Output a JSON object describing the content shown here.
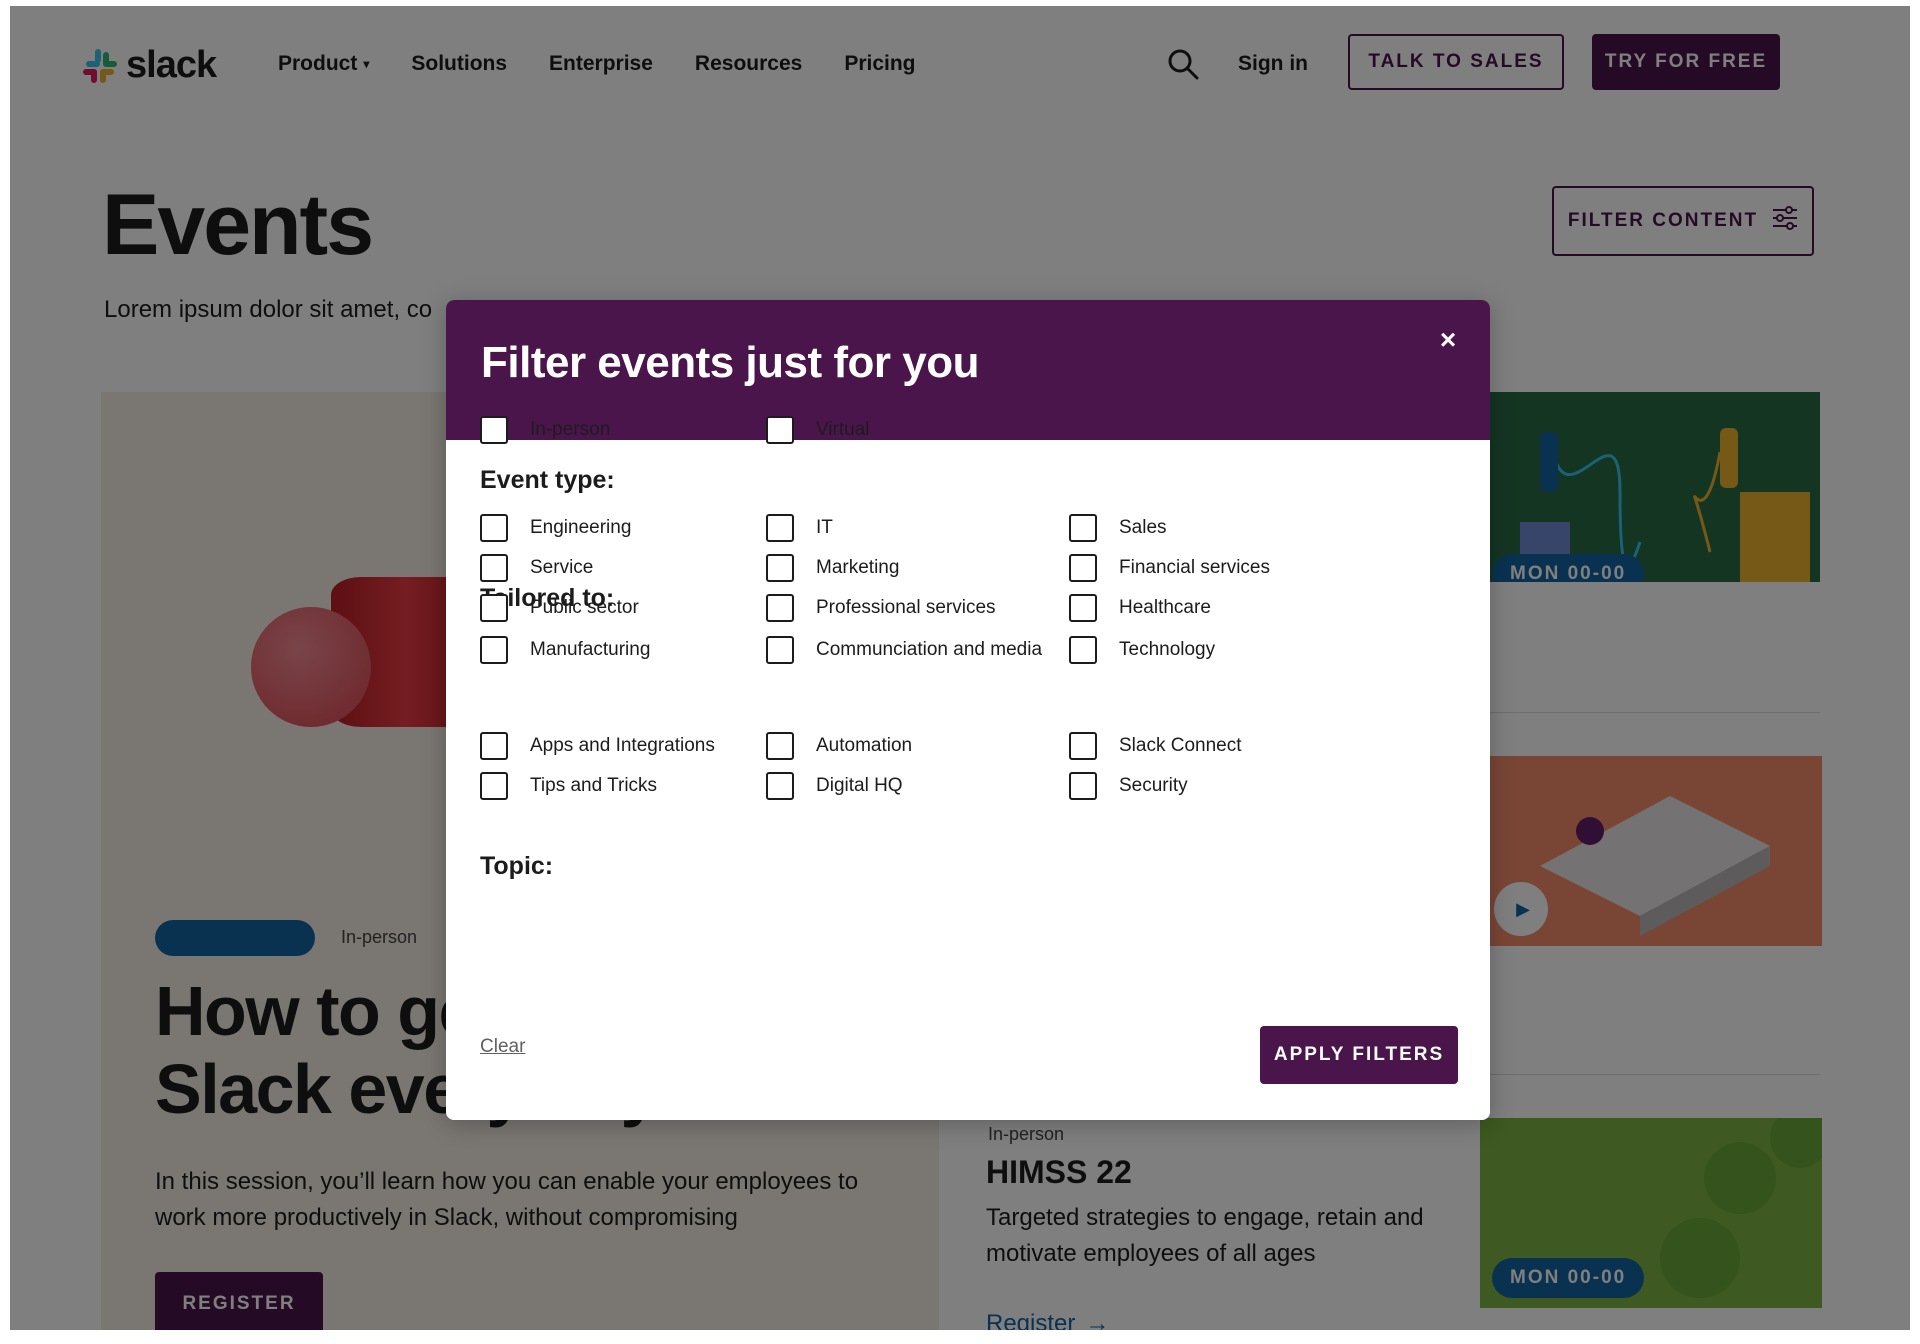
{
  "nav": {
    "logo_text": "slack",
    "links": [
      {
        "label": "Product",
        "has_dropdown": true
      },
      {
        "label": "Solutions"
      },
      {
        "label": "Enterprise"
      },
      {
        "label": "Resources"
      },
      {
        "label": "Pricing"
      }
    ],
    "sign_in": "Sign in",
    "talk_to_sales": "TALK TO SALES",
    "try_free": "TRY FOR FREE"
  },
  "hero": {
    "title": "Events",
    "lead": "Lorem ipsum dolor sit amet, co",
    "filter_button": "FILTER CONTENT"
  },
  "feature": {
    "type": "In-person",
    "title": "How to get more from Slack every day",
    "description": "In this session, you’ll learn how you can enable your employees to work more productively in Slack, without compromising",
    "register": "REGISTER"
  },
  "side_cards": [
    {
      "date": "MON 00-00"
    },
    {
      "date": ""
    },
    {
      "type": "In-person",
      "title": "HIMSS 22",
      "description": "Targeted strategies to engage, retain and motivate employees of all ages",
      "link": "Register",
      "date": "MON 00-00"
    }
  ],
  "modal": {
    "title": "Filter events just for you",
    "close": "×",
    "sections": {
      "event_type": {
        "label": "Event type:",
        "options": [
          "In-person",
          "Virtual"
        ]
      },
      "tailored": {
        "label": "Tailored to:",
        "options": [
          "Engineering",
          "IT",
          "Sales",
          "Service",
          "Marketing",
          "Financial services",
          "Public sector",
          "Professional services",
          "Healthcare",
          "Manufacturing",
          "Communciation and media",
          "Technology"
        ]
      },
      "topic": {
        "label": "Topic:",
        "options": [
          "Apps and Integrations",
          "Automation",
          "Slack Connect",
          "Tips and Tricks",
          "Digital HQ",
          "Security"
        ]
      }
    },
    "clear": "Clear",
    "apply": "APPLY FILTERS"
  },
  "colors": {
    "brand": "#4a154b",
    "accent_blue": "#1264a3"
  }
}
